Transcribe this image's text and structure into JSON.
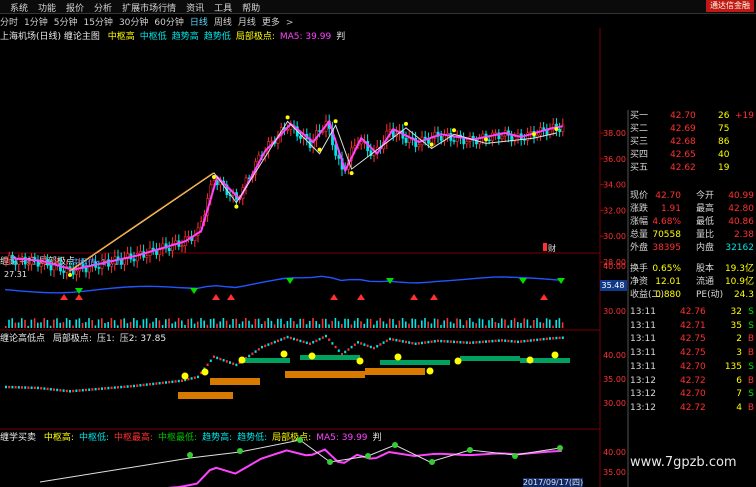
{
  "menu": [
    "系统",
    "功能",
    "报价",
    "分析",
    "扩展市场行情",
    "资讯",
    "工具",
    "帮助"
  ],
  "broker_badge": "通达信金融",
  "timeframes": [
    "分时",
    "1分钟",
    "5分钟",
    "15分钟",
    "30分钟",
    "60分钟",
    "日线",
    "周线",
    "月线",
    "更多"
  ],
  "timeframe_selected": "日线",
  "timeframe_arrow": ">",
  "main_panel": {
    "title": "上海机场(日线) 缠论主图",
    "indicators": [
      {
        "label": "中枢高",
        "color": "#ffff00"
      },
      {
        "label": "中枢低",
        "color": "#00e5e5"
      },
      {
        "label": "趋势高",
        "color": "#00e5e5"
      },
      {
        "label": "趋势低",
        "color": "#00e5e5"
      },
      {
        "label": "局部极点:",
        "color": "#ffff00"
      },
      {
        "label": "MA5: 39.99",
        "color": "#ff44ff"
      },
      {
        "label": "判",
        "color": "#e8e8e8"
      }
    ],
    "price_ticks": [
      "38.00",
      "36.00",
      "34.00",
      "32.00",
      "30.00",
      "28.00"
    ],
    "low_label": "27.31",
    "cai_label": "财"
  },
  "panel2": {
    "title": "缠论中枢 局部极点:",
    "sub_label": "中枢值: 12.13",
    "value_box": "35.48",
    "ticks": [
      "40.00",
      "30.00"
    ]
  },
  "panel3": {
    "title": "缠论高低点",
    "items": [
      "局部极点:",
      "压1:",
      "压2: 37.85"
    ],
    "ticks": [
      "40.00",
      "35.00",
      "30.00"
    ]
  },
  "panel4": {
    "title": "缠学买卖",
    "items": [
      {
        "label": "中枢高:",
        "color": "#ffff00"
      },
      {
        "label": "中枢低:",
        "color": "#00e5e5"
      },
      {
        "label": "中枢最高:",
        "color": "#ff3030"
      },
      {
        "label": "中枢最低:",
        "color": "#00c000"
      },
      {
        "label": "趋势高:",
        "color": "#00e5e5"
      },
      {
        "label": "趋势低:",
        "color": "#00e5e5"
      },
      {
        "label": "局部极点:",
        "color": "#ffff00"
      },
      {
        "label": "MA5: 39.99",
        "color": "#ff44ff"
      },
      {
        "label": "判",
        "color": "#e8e8e8"
      }
    ],
    "ticks": [
      "40.00",
      "35.00",
      "30.00"
    ],
    "bottom_date": "2017/09/17(四)"
  },
  "orderbook": [
    {
      "label": "买一",
      "price": "42.70",
      "vol": "26",
      "extra": "+19"
    },
    {
      "label": "买二",
      "price": "42.69",
      "vol": "75",
      "extra": ""
    },
    {
      "label": "买三",
      "price": "42.68",
      "vol": "86",
      "extra": ""
    },
    {
      "label": "买四",
      "price": "42.65",
      "vol": "40",
      "extra": ""
    },
    {
      "label": "买五",
      "price": "42.62",
      "vol": "19",
      "extra": ""
    }
  ],
  "quote": [
    {
      "l1": "现价",
      "v1": "42.70",
      "l2": "今开",
      "v2": "40.99"
    },
    {
      "l1": "涨跌",
      "v1": "1.91",
      "l2": "最高",
      "v2": "42.80"
    },
    {
      "l1": "涨幅",
      "v1": "4.68%",
      "l2": "最低",
      "v2": "40.86"
    },
    {
      "l1": "总量",
      "v1": "70558",
      "l2": "量比",
      "v2": "2.38"
    },
    {
      "l1": "外盘",
      "v1": "38395",
      "l2": "内盘",
      "v2": "32162"
    }
  ],
  "fin": [
    {
      "l1": "换手",
      "v1": "0.65%",
      "l2": "股本",
      "v2": "19.3亿"
    },
    {
      "l1": "净资",
      "v1": "12.01",
      "l2": "流通",
      "v2": "10.9亿"
    },
    {
      "l1": "收益(二)",
      "v1": "0.880",
      "l2": "PE(动)",
      "v2": "24.3"
    }
  ],
  "ticks_list": [
    {
      "time": "13:11",
      "price": "42.76",
      "vol": "32",
      "side": "S"
    },
    {
      "time": "13:11",
      "price": "42.71",
      "vol": "35",
      "side": "S"
    },
    {
      "time": "13:11",
      "price": "42.75",
      "vol": "2",
      "side": "B"
    },
    {
      "time": "13:11",
      "price": "42.75",
      "vol": "3",
      "side": "B"
    },
    {
      "time": "13:11",
      "price": "42.70",
      "vol": "135",
      "side": "S"
    },
    {
      "time": "13:12",
      "price": "42.72",
      "vol": "6",
      "side": "B"
    },
    {
      "time": "13:12",
      "price": "42.70",
      "vol": "7",
      "side": "S"
    },
    {
      "time": "13:12",
      "price": "42.72",
      "vol": "4",
      "side": "B"
    }
  ],
  "watermark": "www.7gpzb.com",
  "colors": {
    "up": "#ff3030",
    "down": "#00e5e5",
    "ma": "#ff44ff",
    "level": "#ffff00",
    "price": "#ffffff"
  }
}
